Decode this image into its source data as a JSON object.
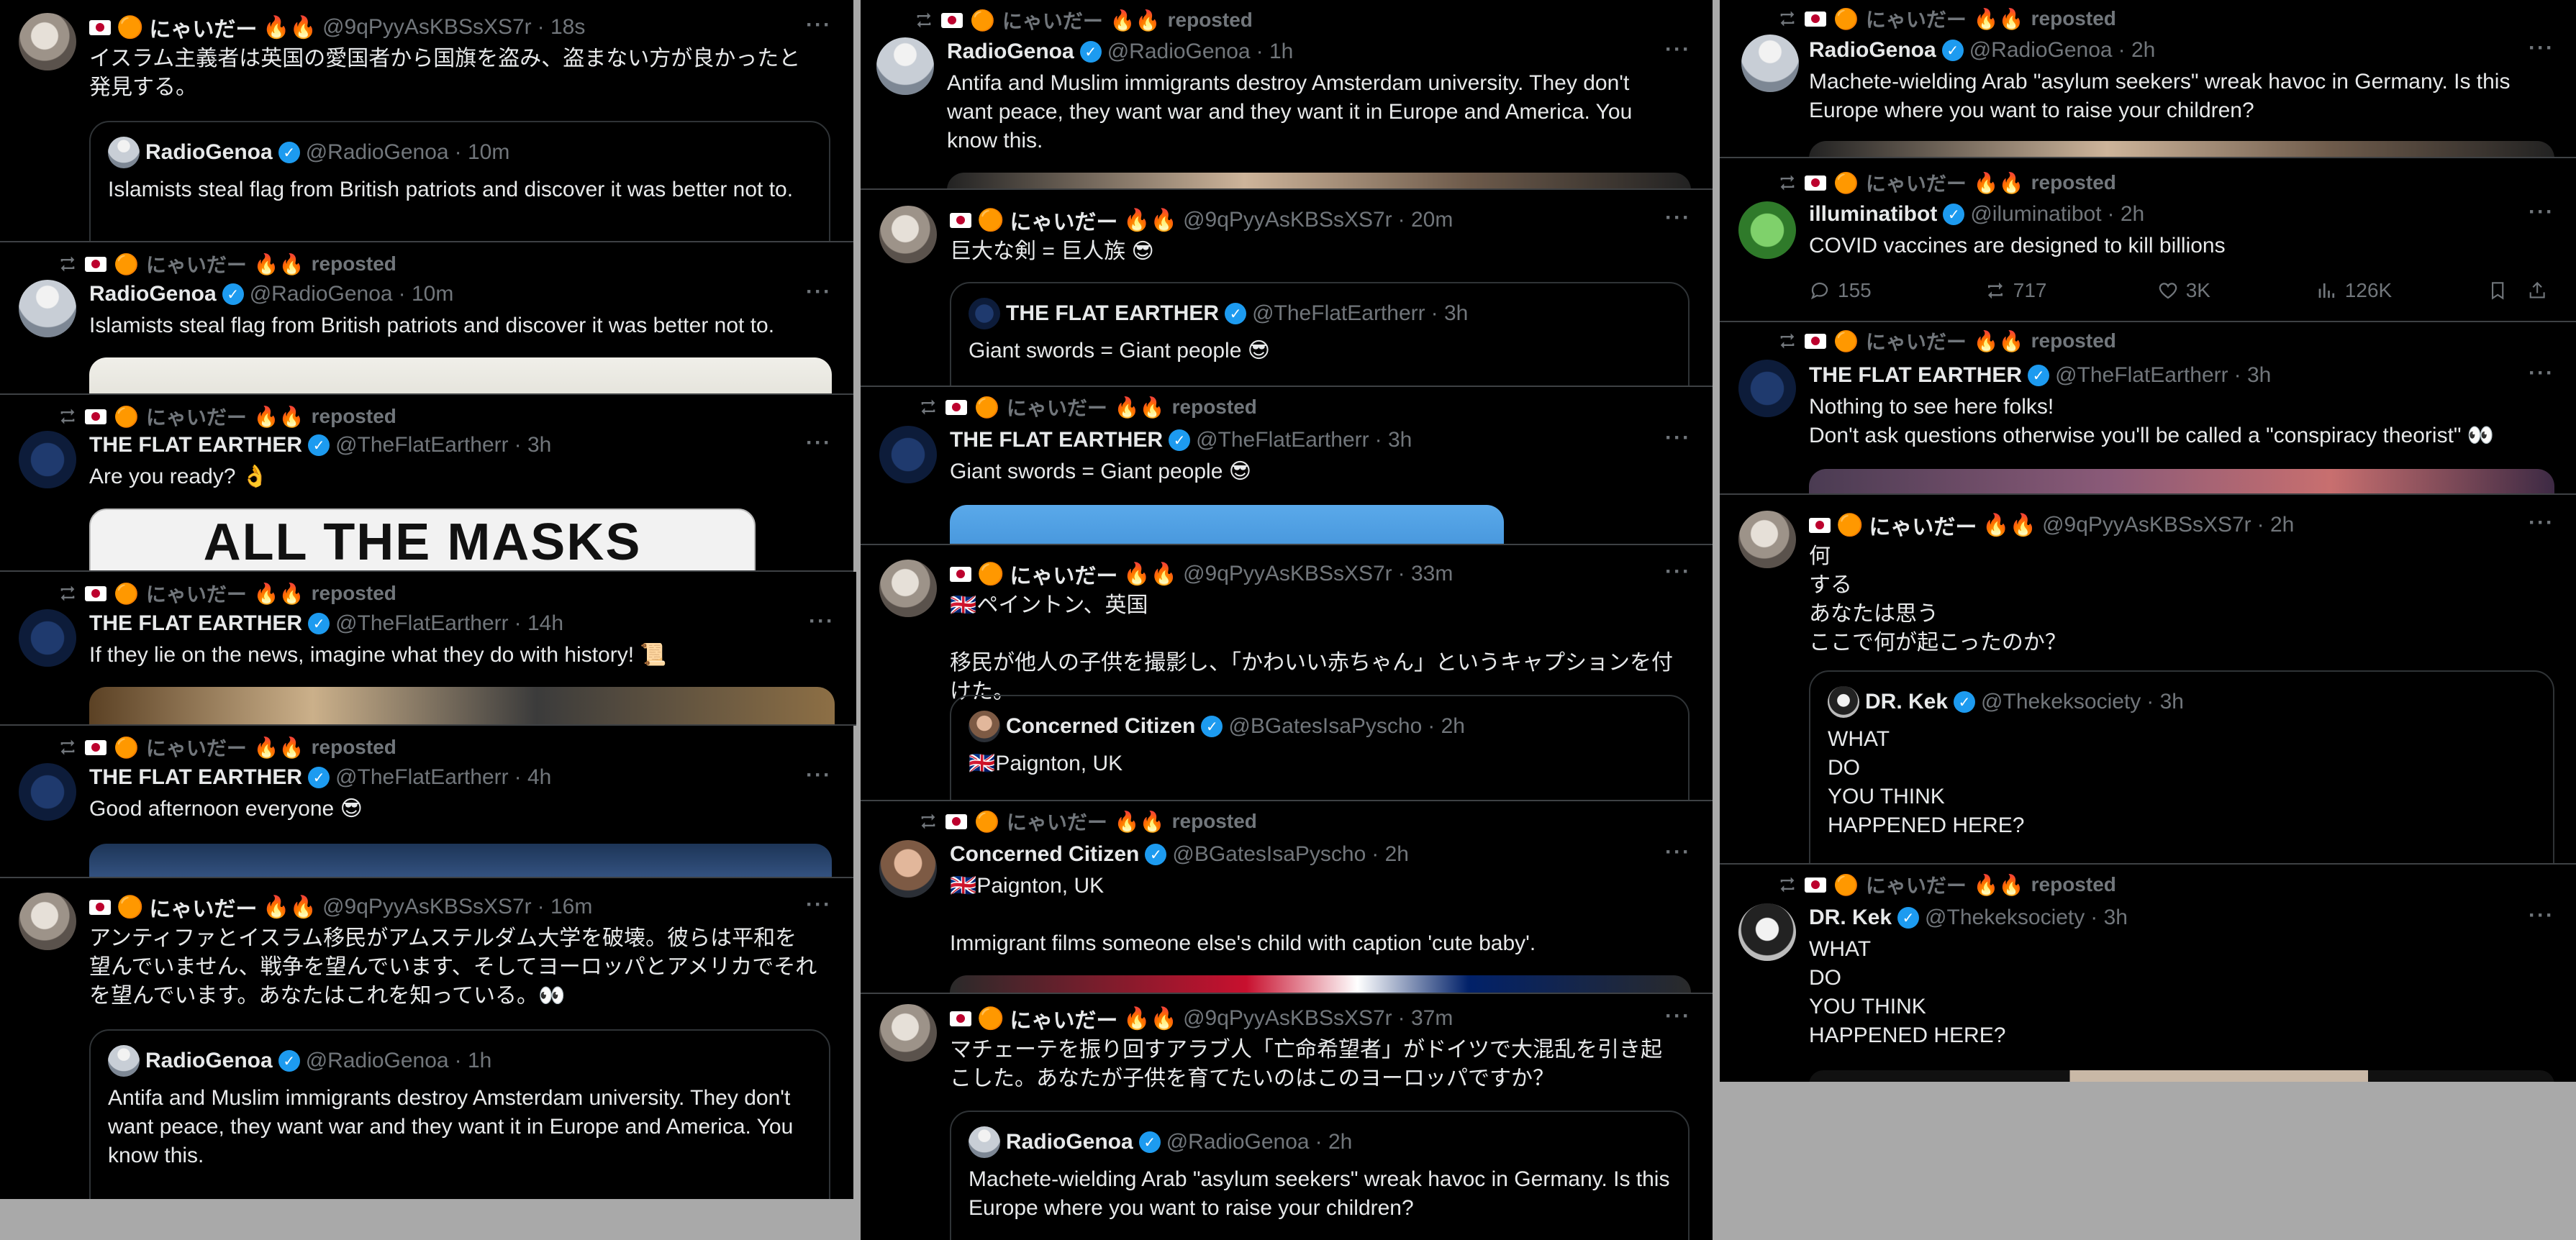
{
  "user": {
    "name": "にゃいだー",
    "handle": "@9qPyyAsKBSsXS7r"
  },
  "reposted_label": "reposted",
  "dots": "···",
  "verified": "✓",
  "col1": [
    {
      "time": "· 18s",
      "text": "イスラム主義者は英国の愛国者から国旗を盗み、盗まない方が良かったと発見する。",
      "quote": {
        "name": "RadioGenoa",
        "handle": "@RadioGenoa",
        "time": "· 10m",
        "text": "Islamists steal flag from British patriots and discover it was better not to."
      }
    },
    {
      "name": "RadioGenoa",
      "handle": "@RadioGenoa",
      "time": "· 10m",
      "text": "Islamists steal flag from British patriots and discover it was better not to."
    },
    {
      "name": "THE FLAT EARTHER",
      "handle": "@TheFlatEartherr",
      "time": "· 3h",
      "text": "Are you ready? 👌",
      "media_text": "ALL THE MASKS"
    },
    {
      "name": "THE FLAT EARTHER",
      "handle": "@TheFlatEartherr",
      "time": "· 14h",
      "text": "If they lie on the news, imagine what they do with history! 📜"
    },
    {
      "name": "THE FLAT EARTHER",
      "handle": "@TheFlatEartherr",
      "time": "· 4h",
      "text": "Good afternoon everyone 😎"
    },
    {
      "time": "· 16m",
      "text": "アンティファとイスラム移民がアムステルダム大学を破壊。彼らは平和を望んでいません、戦争を望んでいます、そしてヨーロッパとアメリカでそれを望んでいます。あなたはこれを知っている。👀",
      "quote": {
        "name": "RadioGenoa",
        "handle": "@RadioGenoa",
        "time": "· 1h",
        "text": "Antifa and Muslim immigrants destroy Amsterdam university. They don't want peace, they want war and they want it in Europe and America. You know this."
      }
    }
  ],
  "col2": [
    {
      "name": "RadioGenoa",
      "handle": "@RadioGenoa",
      "time": "· 1h",
      "text": "Antifa and Muslim immigrants destroy Amsterdam university. They don't want peace, they want war and they want it in Europe and America. You know this."
    },
    {
      "time": "· 20m",
      "text": "巨大な剣 = 巨人族 😎",
      "quote": {
        "name": "THE FLAT EARTHER",
        "handle": "@TheFlatEartherr",
        "time": "· 3h",
        "text": "Giant swords = Giant people 😎"
      }
    },
    {
      "name": "THE FLAT EARTHER",
      "handle": "@TheFlatEartherr",
      "time": "· 3h",
      "text": "Giant swords = Giant people 😎"
    },
    {
      "time": "· 33m",
      "text": "🇬🇧ペイントン、英国\n\n移民が他人の子供を撮影し、「かわいい赤ちゃん」というキャプションを付けた。",
      "quote": {
        "name": "Concerned Citizen",
        "handle": "@BGatesIsaPyscho",
        "time": "· 2h",
        "text": "🇬🇧Paignton, UK"
      }
    },
    {
      "name": "Concerned Citizen",
      "handle": "@BGatesIsaPyscho",
      "time": "· 2h",
      "text": "🇬🇧Paignton, UK\n\nImmigrant films someone else's child with caption 'cute baby'."
    },
    {
      "time": "· 37m",
      "text": "マチェーテを振り回すアラブ人「亡命希望者」がドイツで大混乱を引き起こした。あなたが子供を育てたいのはこのヨーロッパですか？",
      "quote": {
        "name": "RadioGenoa",
        "handle": "@RadioGenoa",
        "time": "· 2h",
        "text": "Machete-wielding Arab \"asylum seekers\" wreak havoc in Germany. Is this Europe where you want to raise your children?"
      }
    }
  ],
  "col3": [
    {
      "name": "RadioGenoa",
      "handle": "@RadioGenoa",
      "time": "· 2h",
      "text": "Machete-wielding Arab \"asylum seekers\" wreak havoc in Germany. Is this Europe where you want to raise your children?"
    },
    {
      "name": "illuminatibot",
      "handle": "@iluminatibot",
      "time": "· 2h",
      "text": "COVID vaccines are designed to kill billions",
      "stats": {
        "replies": "155",
        "reposts": "717",
        "likes": "3K",
        "views": "126K"
      }
    },
    {
      "name": "THE FLAT EARTHER",
      "handle": "@TheFlatEartherr",
      "time": "· 3h",
      "text": "Nothing to see here folks!\nDon't ask questions otherwise you'll be called a \"conspiracy theorist\" 👀"
    },
    {
      "time": "· 2h",
      "text": "何\nする\n            あなたは思う\nここで何が起こったのか？",
      "quote": {
        "name": "DR. Kek",
        "handle": "@Thekeksociety",
        "time": "· 3h",
        "text": "WHAT\nDO\n            YOU THINK\nHAPPENED HERE?"
      }
    },
    {
      "name": "DR. Kek",
      "handle": "@Thekeksociety",
      "time": "· 3h",
      "text": "WHAT\nDO\n            YOU THINK\nHAPPENED HERE?"
    }
  ]
}
